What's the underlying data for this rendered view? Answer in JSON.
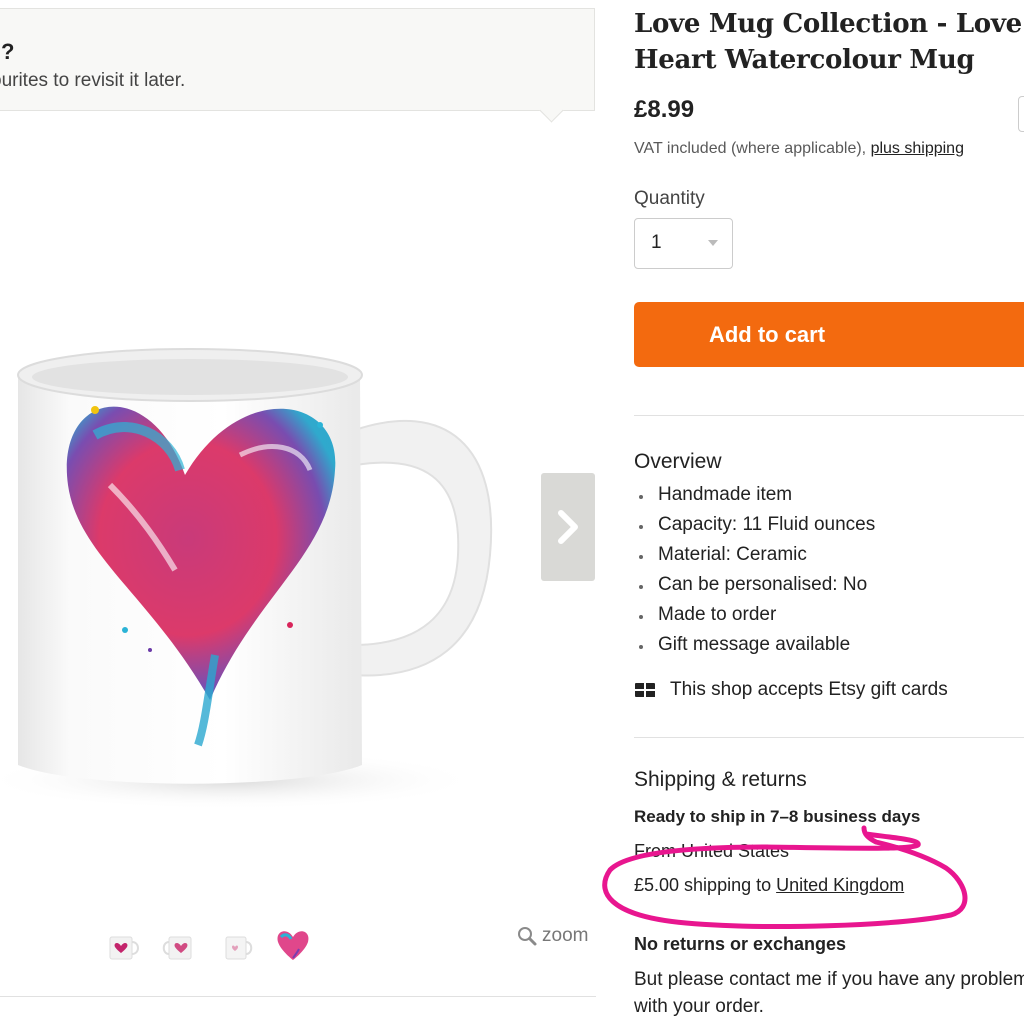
{
  "favourite_banner": {
    "question_mark": "?",
    "message": "ourites to revisit it later."
  },
  "gallery": {
    "main_image": "white-ceramic-mug-with-watercolour-heart",
    "next_icon": "chevron-right-icon",
    "thumbnails": [
      "mug-front-thumbnail",
      "mug-angle-thumbnail",
      "mug-plain-thumbnail",
      "watercolour-heart-thumbnail"
    ],
    "zoom_label": "zoom",
    "zoom_icon": "magnifier-icon"
  },
  "product": {
    "title": "Love Mug Collection - Love Heart Watercolour Mug",
    "price": "£8.99",
    "vat_text": "VAT included (where applicable),",
    "shipping_link": "plus shipping"
  },
  "purchase": {
    "quantity_label": "Quantity",
    "quantity_value": "1",
    "add_to_cart": "Add to cart",
    "button_color": "#f36a0f"
  },
  "overview": {
    "heading": "Overview",
    "items": [
      "Handmade item",
      "Capacity: 11 Fluid ounces",
      "Material: Ceramic",
      "Can be personalised: No",
      "Made to order",
      "Gift message available"
    ],
    "gift_cards": "This shop accepts Etsy gift cards",
    "gift_icon": "gift-card-icon"
  },
  "shipping": {
    "heading": "Shipping & returns",
    "ready": "Ready to ship in 7–8 business days",
    "from": "From United States",
    "cost_prefix": "£5.00 shipping to",
    "destination": "United Kingdom",
    "highlight_color": "#e8168f",
    "returns": "No returns or exchanges",
    "contact": "But please contact me if you have any problems with your order."
  }
}
